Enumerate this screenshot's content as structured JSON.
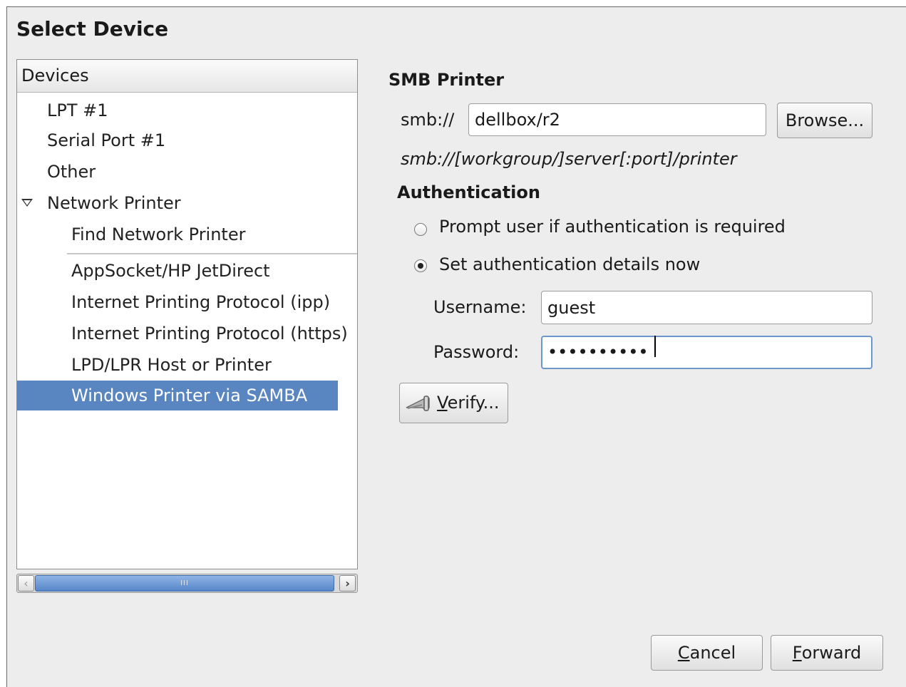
{
  "dialog": {
    "title": "Select Device"
  },
  "devices": {
    "header": "Devices",
    "items": [
      {
        "label": "LPT #1"
      },
      {
        "label": "Serial Port #1"
      },
      {
        "label": "Other"
      },
      {
        "label": "Network Printer",
        "expanded": true
      },
      {
        "label": "Find Network Printer"
      },
      {
        "label": "AppSocket/HP JetDirect"
      },
      {
        "label": "Internet Printing Protocol (ipp)"
      },
      {
        "label": "Internet Printing Protocol (https)"
      },
      {
        "label": "LPD/LPR Host or Printer"
      },
      {
        "label": "Windows Printer via SAMBA",
        "selected": true
      }
    ],
    "scrollbar": {
      "left_icon": "chevron-left-icon",
      "right_icon": "chevron-right-icon",
      "grip": "III"
    }
  },
  "smb": {
    "heading": "SMB Printer",
    "prefix": "smb://",
    "uri_value": "dellbox/r2",
    "browse_label": "Browse...",
    "hint": "smb://[workgroup/]server[:port]/printer"
  },
  "auth": {
    "heading": "Authentication",
    "option_prompt": "Prompt user if authentication is required",
    "option_set": "Set authentication details now",
    "selected_option": "set",
    "username_label": "Username:",
    "username_value": "guest",
    "password_label": "Password:",
    "password_masked": "••••••••••",
    "verify_label_accel": "V",
    "verify_label_rest": "erify...",
    "verify_icon": "key-icon"
  },
  "footer": {
    "cancel_accel": "C",
    "cancel_rest": "ancel",
    "forward_accel": "F",
    "forward_rest": "orward"
  },
  "colors": {
    "selection": "#5985c1",
    "dialog_bg": "#ededed",
    "focus_border": "#6e97cc"
  }
}
